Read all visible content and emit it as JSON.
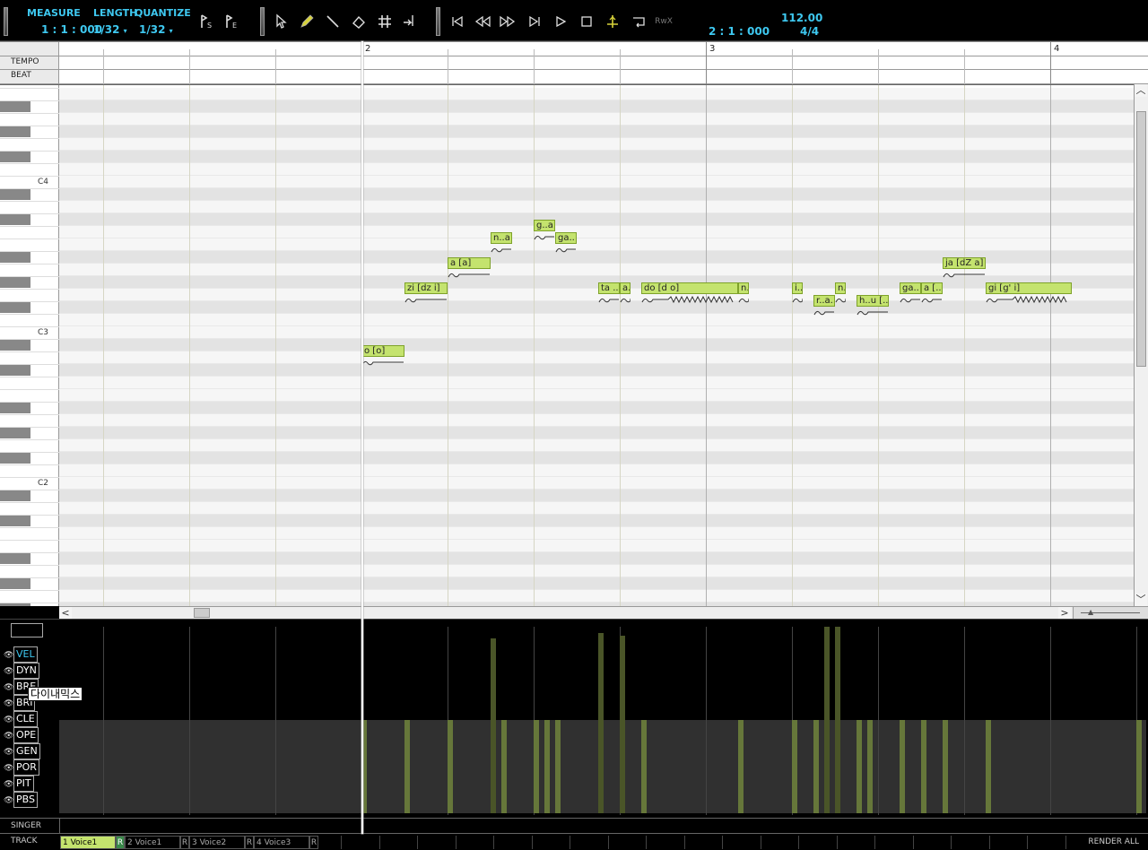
{
  "toolbar": {
    "measure_label": "MEASURE",
    "measure_value": "1 : 1 : 000",
    "length_label": "LENGTH",
    "length_value": "1/32",
    "quantize_label": "QUANTIZE",
    "quantize_value": "1/32",
    "position_value": "2 : 1 : 000",
    "tempo_value": "112.00",
    "beat_value": "4/4",
    "rwx_label": "RwX"
  },
  "ruler": {
    "tempo_label": "TEMPO",
    "beat_label": "BEAT",
    "bars": [
      "2",
      "3",
      "4"
    ]
  },
  "keys": {
    "labels": [
      "C4",
      "C3",
      "C2"
    ]
  },
  "notes": [
    {
      "lyric": "o [o]",
      "bar": 2.0,
      "len": 0.125,
      "row": 21
    },
    {
      "lyric": "zi [dz i]",
      "bar": 2.125,
      "len": 0.125,
      "row": 16
    },
    {
      "lyric": "a [a]",
      "bar": 2.25,
      "len": 0.125,
      "row": 14
    },
    {
      "lyric": "n..a [...",
      "bar": 2.375,
      "len": 0.0625,
      "row": 12
    },
    {
      "lyric": "ga..",
      "bar": 2.5625,
      "len": 0.0625,
      "row": 12
    },
    {
      "lyric": "g..a..",
      "bar": 2.5,
      "len": 0.0625,
      "row": 11
    },
    {
      "lyric": "ta ..",
      "bar": 2.6875,
      "len": 0.0625,
      "row": 16
    },
    {
      "lyric": "a..",
      "bar": 2.75,
      "len": 0.03125,
      "row": 16
    },
    {
      "lyric": "do [d o]",
      "bar": 2.8125,
      "len": 0.28125,
      "row": 16
    },
    {
      "lyric": "n..",
      "bar": 3.09375,
      "len": 0.03125,
      "row": 16
    },
    {
      "lyric": "i..",
      "bar": 3.25,
      "len": 0.03125,
      "row": 16
    },
    {
      "lyric": "n..",
      "bar": 3.375,
      "len": 0.03125,
      "row": 16
    },
    {
      "lyric": "r..a..",
      "bar": 3.3125,
      "len": 0.0625,
      "row": 17
    },
    {
      "lyric": "h..u [...",
      "bar": 3.4375,
      "len": 0.09375,
      "row": 17
    },
    {
      "lyric": "ga..",
      "bar": 3.5625,
      "len": 0.0625,
      "row": 16
    },
    {
      "lyric": "a [...",
      "bar": 3.625,
      "len": 0.0625,
      "row": 16
    },
    {
      "lyric": "ja [dZ a]",
      "bar": 3.6875,
      "len": 0.125,
      "row": 14
    },
    {
      "lyric": "gi [g' i]",
      "bar": 3.8125,
      "len": 0.25,
      "row": 16
    }
  ],
  "params": [
    {
      "name": "VEL",
      "active": true
    },
    {
      "name": "DYN",
      "active": false
    },
    {
      "name": "BRE",
      "active": false
    },
    {
      "name": "BRI",
      "active": false
    },
    {
      "name": "CLE",
      "active": false
    },
    {
      "name": "OPE",
      "active": false
    },
    {
      "name": "GEN",
      "active": false
    },
    {
      "name": "POR",
      "active": false
    },
    {
      "name": "PIT",
      "active": false
    },
    {
      "name": "PBS",
      "active": false
    }
  ],
  "velocity_bars": [
    {
      "bar": 2.0,
      "value": 64
    },
    {
      "bar": 2.125,
      "value": 64
    },
    {
      "bar": 2.25,
      "value": 64
    },
    {
      "bar": 2.375,
      "value": 120
    },
    {
      "bar": 2.40625,
      "value": 64
    },
    {
      "bar": 2.5,
      "value": 64
    },
    {
      "bar": 2.53125,
      "value": 64
    },
    {
      "bar": 2.5625,
      "value": 64
    },
    {
      "bar": 2.6875,
      "value": 124
    },
    {
      "bar": 2.75,
      "value": 122
    },
    {
      "bar": 2.8125,
      "value": 64
    },
    {
      "bar": 3.09375,
      "value": 64
    },
    {
      "bar": 3.25,
      "value": 64
    },
    {
      "bar": 3.3125,
      "value": 64
    },
    {
      "bar": 3.34375,
      "value": 128
    },
    {
      "bar": 3.375,
      "value": 128
    },
    {
      "bar": 3.4375,
      "value": 64
    },
    {
      "bar": 3.46875,
      "value": 64
    },
    {
      "bar": 3.5625,
      "value": 64
    },
    {
      "bar": 3.625,
      "value": 64
    },
    {
      "bar": 3.6875,
      "value": 64
    },
    {
      "bar": 3.8125,
      "value": 64
    },
    {
      "bar": 4.25,
      "value": 64
    }
  ],
  "tooltip": "다이내믹스",
  "singer_label": "SINGER",
  "track_label": "TRACK",
  "tracks": [
    {
      "name": "1 Voice1",
      "active": true,
      "r": "R",
      "r_active": true
    },
    {
      "name": "2 Voice1",
      "active": false,
      "r": "R",
      "r_active": false
    },
    {
      "name": "3 Voice2",
      "active": false,
      "r": "R",
      "r_active": false
    },
    {
      "name": "4 Voice3",
      "active": false,
      "r": "R",
      "r_active": false
    }
  ],
  "render_all": "RENDER ALL",
  "colors": {
    "accent": "#3ec8f0",
    "note": "#c4e36e",
    "note_border": "#7ea22a",
    "vel_bar": "#66773a"
  }
}
